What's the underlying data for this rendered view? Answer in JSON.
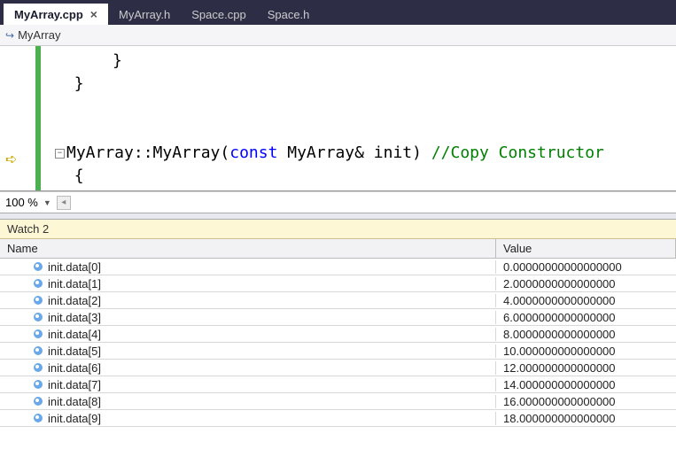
{
  "tabs": [
    {
      "label": "MyArray.cpp",
      "active": true,
      "closeable": true
    },
    {
      "label": "MyArray.h",
      "active": false,
      "closeable": false
    },
    {
      "label": "Space.cpp",
      "active": false,
      "closeable": false
    },
    {
      "label": "Space.h",
      "active": false,
      "closeable": false
    }
  ],
  "breadcrumb": {
    "current": "MyArray"
  },
  "editor": {
    "brace1": "}",
    "brace2": "}",
    "sig_prefix": "MyArray::MyArray(",
    "sig_kw": "const",
    "sig_mid": " MyArray& init) ",
    "sig_comment": "//Copy Constructor",
    "open_brace": "{"
  },
  "zoom": {
    "level": "100 %"
  },
  "watch": {
    "title": "Watch 2",
    "columns": {
      "name": "Name",
      "value": "Value"
    },
    "rows": [
      {
        "name": "init.data[0]",
        "value": "0.00000000000000000"
      },
      {
        "name": "init.data[1]",
        "value": "2.0000000000000000"
      },
      {
        "name": "init.data[2]",
        "value": "4.0000000000000000"
      },
      {
        "name": "init.data[3]",
        "value": "6.0000000000000000"
      },
      {
        "name": "init.data[4]",
        "value": "8.0000000000000000"
      },
      {
        "name": "init.data[5]",
        "value": "10.000000000000000"
      },
      {
        "name": "init.data[6]",
        "value": "12.000000000000000"
      },
      {
        "name": "init.data[7]",
        "value": "14.000000000000000"
      },
      {
        "name": "init.data[8]",
        "value": "16.000000000000000"
      },
      {
        "name": "init.data[9]",
        "value": "18.000000000000000"
      }
    ]
  }
}
